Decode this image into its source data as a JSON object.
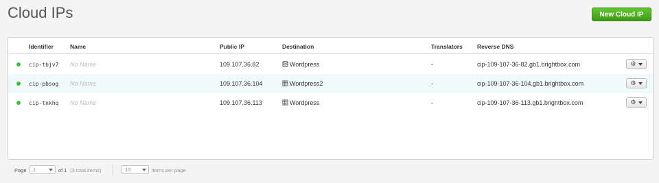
{
  "header": {
    "title": "Cloud IPs",
    "new_button_label": "New Cloud IP"
  },
  "table": {
    "columns": {
      "identifier": "Identifier",
      "name": "Name",
      "public_ip": "Public IP",
      "destination": "Destination",
      "translators": "Translators",
      "reverse_dns": "Reverse DNS"
    },
    "rows": [
      {
        "status": "active",
        "identifier": "cip-tbjv7",
        "name": "No Name",
        "public_ip": "109.107.36.82",
        "destination_icon": "database-icon",
        "destination": "Wordpress",
        "translators": "-",
        "reverse_dns": "cip-109-107-36-82.gb1.brightbox.com"
      },
      {
        "status": "active",
        "identifier": "cip-pbsog",
        "name": "No Name",
        "public_ip": "109.107.36.104",
        "destination_icon": "server-icon",
        "destination": "Wordpress2",
        "translators": "-",
        "reverse_dns": "cip-109-107-36-104.gb1.brightbox.com"
      },
      {
        "status": "active",
        "identifier": "cip-tnkhq",
        "name": "No Name",
        "public_ip": "109.107.36.113",
        "destination_icon": "server-icon",
        "destination": "Wordpress",
        "translators": "-",
        "reverse_dns": "cip-109-107-36-113.gb1.brightbox.com"
      }
    ]
  },
  "pagination": {
    "page_label": "Page",
    "page_value": "1",
    "of_label": "of 1",
    "total_items": "(3 total items)",
    "per_page_value": "10",
    "per_page_label": "items per page"
  },
  "colors": {
    "accent_green": "#4caf22",
    "status_active": "#3ebd3e",
    "row_highlight": "#f1fafb"
  }
}
